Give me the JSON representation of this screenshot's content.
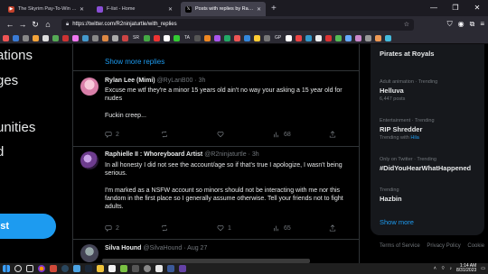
{
  "browser": {
    "tabs": [
      {
        "title": "The Skyrim Pay-To-Win Challe...",
        "active": false,
        "icon_color": "#c4412b"
      },
      {
        "title": "F-list - Home",
        "active": false,
        "icon_color": "#8a4fd6"
      },
      {
        "title": "Posts with replies by Raphielle...",
        "active": true,
        "icon_color": "#000000"
      }
    ],
    "new_tab": "+",
    "url": "https://twitter.com/R2ninjaturtle/with_replies",
    "window_controls": [
      "—",
      "❐",
      "✕"
    ],
    "bookmark_labels": [
      "SR",
      "TA",
      "GP"
    ]
  },
  "left_nav": {
    "items": [
      "ations",
      "ges",
      "unities",
      "d"
    ],
    "post_button": "st"
  },
  "main": {
    "show_more_top": "Show more replies",
    "tweets": [
      {
        "display_name": "Rylan Lee (Mimi)",
        "handle": "@RyLanB00",
        "time": "· 3h",
        "text": [
          "Excuse me wtf they're a minor 15 years old ain't no way your asking a 15 year old for nudes",
          "Fuckin creep..."
        ],
        "replies": "2",
        "retweets": "",
        "likes": "",
        "views": "68"
      },
      {
        "display_name": "Raphielle II : Whoreyboard Artist",
        "handle": "@R2ninjaturtle",
        "time": "· 3h",
        "text": [
          "In all honesty I did not see the account/age so if that's true I apologize, I wasn't being serious.",
          "I'm marked as a NSFW account so minors should not be interacting with me nor this fandom in the first place so I generally assume otherwise. Tell your friends not to fight adults."
        ],
        "replies": "2",
        "retweets": "",
        "likes": "1",
        "views": "65"
      },
      {
        "display_name": "Silva Hound",
        "handle": "@SilvaHound",
        "time": "· Aug 27"
      }
    ]
  },
  "sidebar": {
    "top_trend": "Pirates at Royals",
    "trends": [
      {
        "category": "Adult animation · Trending",
        "name": "Helluva",
        "count": "6,447 posts",
        "extra": ""
      },
      {
        "category": "Entertainment · Trending",
        "name": "RIP Shredder",
        "count": "Trending with ",
        "extra": "Hila"
      },
      {
        "category": "Only on Twitter · Trending",
        "name": "#DidYouHearWhatHappened",
        "count": "",
        "extra": ""
      },
      {
        "category": "Trending",
        "name": "Hazbin",
        "count": "",
        "extra": ""
      }
    ],
    "show_more": "Show more",
    "footer": [
      "Terms of Service",
      "Privacy Policy",
      "Cookie"
    ]
  },
  "taskbar": {
    "time": "1:14 AM",
    "date": "8/31/2023"
  },
  "colors": {
    "accent": "#1d9bf0",
    "background": "#000000",
    "card": "#16181c",
    "muted": "#71767b"
  }
}
